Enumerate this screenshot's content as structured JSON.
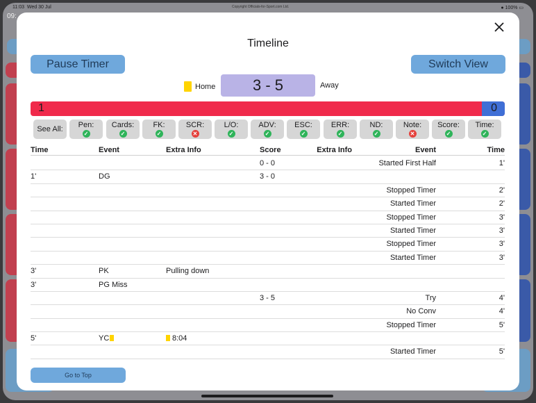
{
  "status_bar": {
    "time": "11:03",
    "date": "Wed 30 Jul",
    "copyright": "Copyright Officials-for-Sport.com Ltd.",
    "battery": "100%"
  },
  "background": {
    "fragment": "09:"
  },
  "modal": {
    "title": "Timeline",
    "pause_button": "Pause Timer",
    "switch_button": "Switch View",
    "go_top_button": "Go to Top"
  },
  "score": {
    "home_label": "Home",
    "away_label": "Away",
    "display": "3 - 5",
    "home_card_color": "#ffd400"
  },
  "possession": {
    "home_value": "1",
    "away_value": "0",
    "away_fraction": 0.048,
    "home_color": "#f02a4b",
    "away_color": "#3f6fd6"
  },
  "filters": [
    {
      "label": "See All:",
      "status": "none"
    },
    {
      "label": "Pen:",
      "status": "ok"
    },
    {
      "label": "Cards:",
      "status": "ok"
    },
    {
      "label": "FK:",
      "status": "ok"
    },
    {
      "label": "SCR:",
      "status": "no"
    },
    {
      "label": "L/O:",
      "status": "ok"
    },
    {
      "label": "ADV:",
      "status": "ok"
    },
    {
      "label": "ESC:",
      "status": "ok"
    },
    {
      "label": "ERR:",
      "status": "ok"
    },
    {
      "label": "ND:",
      "status": "ok"
    },
    {
      "label": "Note:",
      "status": "no"
    },
    {
      "label": "Score:",
      "status": "ok"
    },
    {
      "label": "Time:",
      "status": "ok"
    }
  ],
  "timeline": {
    "headers": {
      "left_time": "Time",
      "left_event": "Event",
      "left_extra": "Extra Info",
      "score": "Score",
      "right_extra": "Extra Info",
      "right_event": "Event",
      "right_time": "Time"
    },
    "rows": [
      {
        "lt": "",
        "le": "",
        "lx": "",
        "sc": "0 - 0",
        "rx": "",
        "re": "Started First Half",
        "rt": "1'"
      },
      {
        "lt": "1'",
        "le": "DG",
        "lx": "",
        "sc": "3 - 0",
        "rx": "",
        "re": "",
        "rt": ""
      },
      {
        "lt": "",
        "le": "",
        "lx": "",
        "sc": "",
        "rx": "",
        "re": "Stopped Timer",
        "rt": "2'"
      },
      {
        "lt": "",
        "le": "",
        "lx": "",
        "sc": "",
        "rx": "",
        "re": "Started Timer",
        "rt": "2'"
      },
      {
        "lt": "",
        "le": "",
        "lx": "",
        "sc": "",
        "rx": "",
        "re": "Stopped Timer",
        "rt": "3'"
      },
      {
        "lt": "",
        "le": "",
        "lx": "",
        "sc": "",
        "rx": "",
        "re": "Started Timer",
        "rt": "3'"
      },
      {
        "lt": "",
        "le": "",
        "lx": "",
        "sc": "",
        "rx": "",
        "re": "Stopped Timer",
        "rt": "3'"
      },
      {
        "lt": "",
        "le": "",
        "lx": "",
        "sc": "",
        "rx": "",
        "re": "Started Timer",
        "rt": "3'"
      },
      {
        "lt": "3'",
        "le": "PK",
        "lx": "Pulling down",
        "sc": "",
        "rx": "",
        "re": "",
        "rt": ""
      },
      {
        "lt": "3'",
        "le": "PG Miss",
        "lx": "",
        "sc": "",
        "rx": "",
        "re": "",
        "rt": ""
      },
      {
        "lt": "",
        "le": "",
        "lx": "",
        "sc": "3 - 5",
        "rx": "",
        "re": "Try",
        "rt": "4'"
      },
      {
        "lt": "",
        "le": "",
        "lx": "",
        "sc": "",
        "rx": "",
        "re": "No Conv",
        "rt": "4'"
      },
      {
        "lt": "",
        "le": "",
        "lx": "",
        "sc": "",
        "rx": "",
        "re": "Stopped Timer",
        "rt": "5'"
      },
      {
        "lt": "5'",
        "le": "YC",
        "lx": "8:04",
        "sc": "",
        "rx": "",
        "re": "",
        "rt": "",
        "card": true
      },
      {
        "lt": "",
        "le": "",
        "lx": "",
        "sc": "",
        "rx": "",
        "re": "Started Timer",
        "rt": "5'"
      }
    ]
  }
}
